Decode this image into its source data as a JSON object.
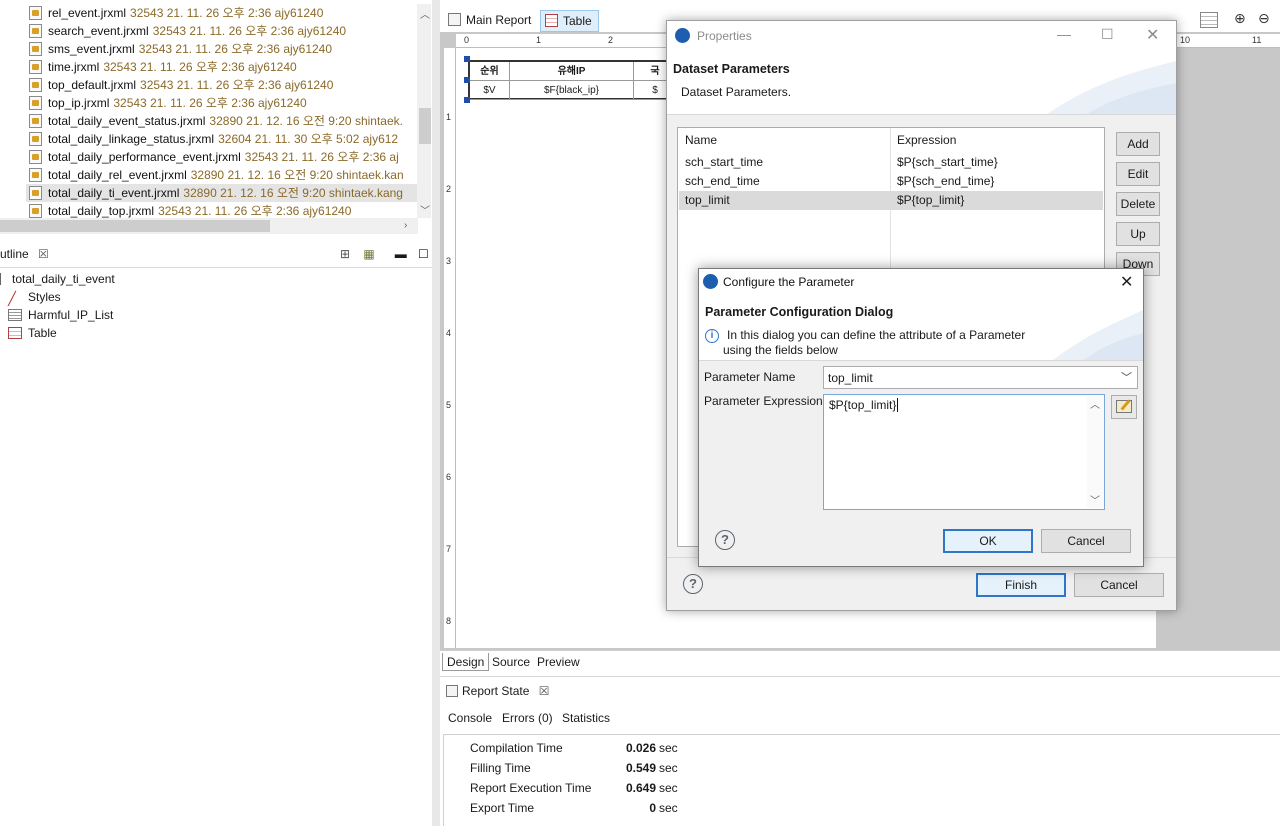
{
  "file_list": {
    "rows": [
      {
        "name": "rel_event.jrxml",
        "meta": "32543  21. 11. 26 오후 2:36  ajy61240"
      },
      {
        "name": "search_event.jrxml",
        "meta": "32543  21. 11. 26 오후 2:36  ajy61240"
      },
      {
        "name": "sms_event.jrxml",
        "meta": "32543  21. 11. 26 오후 2:36  ajy61240"
      },
      {
        "name": "time.jrxml",
        "meta": "32543  21. 11. 26 오후 2:36  ajy61240"
      },
      {
        "name": "top_default.jrxml",
        "meta": "32543  21. 11. 26 오후 2:36  ajy61240"
      },
      {
        "name": "top_ip.jrxml",
        "meta": "32543  21. 11. 26 오후 2:36  ajy61240"
      },
      {
        "name": "total_daily_event_status.jrxml",
        "meta": "32890  21. 12. 16 오전 9:20  shintaek."
      },
      {
        "name": "total_daily_linkage_status.jrxml",
        "meta": "32604  21. 11. 30 오후 5:02  ajy612"
      },
      {
        "name": "total_daily_performance_event.jrxml",
        "meta": "32543  21. 11. 26 오후 2:36  aj"
      },
      {
        "name": "total_daily_rel_event.jrxml",
        "meta": "32890  21. 12. 16 오전 9:20  shintaek.kan"
      },
      {
        "name": "total_daily_ti_event.jrxml",
        "meta": "32890  21. 12. 16 오전 9:20  shintaek.kang"
      },
      {
        "name": "total_daily_top.jrxml",
        "meta": "32543  21. 11. 26 오후 2:36  ajy61240"
      }
    ],
    "selected_index": 10
  },
  "outline": {
    "tab_label": "utline",
    "root": "total_daily_ti_event",
    "children": [
      "Styles",
      "Harmful_IP_List",
      "Table"
    ]
  },
  "editor": {
    "tabs": [
      "Main Report",
      "Table"
    ],
    "active_tab": "Table",
    "bottom_tabs": [
      "Design",
      "Source",
      "Preview"
    ],
    "ruler_top": [
      "0",
      "1",
      "2",
      "10",
      "11"
    ],
    "ruler_left": [
      "1",
      "2",
      "3",
      "4",
      "5",
      "6",
      "7",
      "8"
    ],
    "table": {
      "headers": [
        "순위",
        "유해IP",
        "국"
      ],
      "cells": [
        "$V",
        "$F{black_ip}",
        "$"
      ]
    }
  },
  "report_state": {
    "title": "Report State",
    "tabs": [
      "Console",
      "Errors (0)",
      "Statistics"
    ],
    "stats": [
      {
        "label": "Compilation Time",
        "value": "0.026",
        "unit": "sec"
      },
      {
        "label": "Filling Time",
        "value": "0.549",
        "unit": "sec"
      },
      {
        "label": "Report Execution Time",
        "value": "0.649",
        "unit": "sec"
      },
      {
        "label": "Export Time",
        "value": "0",
        "unit": "sec"
      }
    ]
  },
  "properties_dialog": {
    "title": "Properties",
    "header_title": "Dataset Parameters",
    "header_desc": "Dataset Parameters.",
    "columns": [
      "Name",
      "Expression"
    ],
    "rows": [
      {
        "name": "sch_start_time",
        "expr": "$P{sch_start_time}"
      },
      {
        "name": "sch_end_time",
        "expr": "$P{sch_end_time}"
      },
      {
        "name": "top_limit",
        "expr": "$P{top_limit}"
      }
    ],
    "selected_row": 2,
    "side_buttons": [
      "Add",
      "Edit",
      "Delete",
      "Up",
      "Down"
    ],
    "finish_label": "Finish",
    "cancel_label": "Cancel"
  },
  "config_dialog": {
    "title": "Configure the Parameter",
    "header_title": "Parameter Configuration Dialog",
    "info_line1": "In this dialog you can define the attribute of a Parameter",
    "info_line2": "using the fields below",
    "name_label": "Parameter Name",
    "name_value": "top_limit",
    "expr_label": "Parameter Expression",
    "expr_value": "$P{top_limit}",
    "ok_label": "OK",
    "cancel_label": "Cancel"
  },
  "colors": {
    "accent": "#2f75c8",
    "selection": "#dadada",
    "meta_text": "#8a6a2a"
  }
}
